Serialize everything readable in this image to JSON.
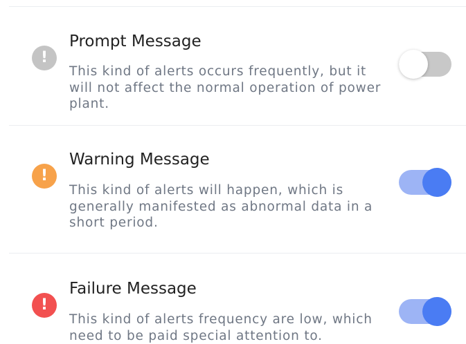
{
  "colors": {
    "prompt_icon": "#c4c4c4",
    "warning_icon": "#f7a24a",
    "failure_icon": "#f25050",
    "toggle_on_track": "#9db4f5",
    "toggle_on_knob": "#4a7cf3",
    "toggle_off_track": "#c8c8c8"
  },
  "alerts": [
    {
      "icon_glyph": "!",
      "icon_name": "info-exclamation-icon",
      "title": "Prompt Message",
      "description": "This kind of alerts occurs frequently, but it will not affect the normal operation of power plant.",
      "enabled": false
    },
    {
      "icon_glyph": "!",
      "icon_name": "warning-exclamation-icon",
      "title": "Warning Message",
      "description": "This kind of alerts will happen, which is generally manifested as abnormal data in a short period.",
      "enabled": true
    },
    {
      "icon_glyph": "!",
      "icon_name": "error-exclamation-icon",
      "title": "Failure Message",
      "description": "This kind of alerts frequency are low, which need to be paid special attention to.",
      "enabled": true
    }
  ]
}
